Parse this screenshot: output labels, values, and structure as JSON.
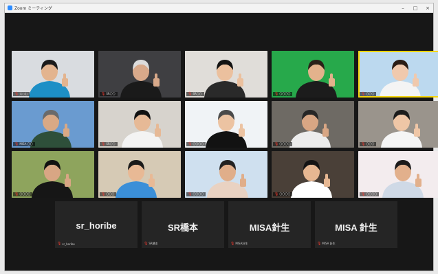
{
  "window": {
    "title": "Zoom ミーティング"
  },
  "tiles": [
    {
      "name": "大○山",
      "bg": "#d9dce0",
      "shirt": "#1d8fc6",
      "skin": "#e3b48f",
      "hair": "#1b1b1b"
    },
    {
      "name": "SR〇〇",
      "bg": "#3f3f42",
      "shirt": "#1a1a1a",
      "skin": "#d8a98a",
      "hair": "#dcdcdc"
    },
    {
      "name": "SR〇〇",
      "bg": "#e0ddd9",
      "shirt": "#2a2a2a",
      "skin": "#ebc09e",
      "hair": "#121212"
    },
    {
      "name": "〇〇〇〇",
      "bg": "#27a94b",
      "shirt": "#1c1c1c",
      "skin": "#e3b28c",
      "hair": "#2a2118"
    },
    {
      "name": "〇〇〇",
      "bg": "#bcd9ef",
      "shirt": "#f4f4f4",
      "skin": "#f0c9ad",
      "hair": "#2a1c14"
    },
    {
      "name": "MISA 〇〇",
      "bg": "#6a9bd0",
      "shirt": "#2e4f3a",
      "skin": "#d9a985",
      "hair": "#6a6a6a"
    },
    {
      "name": "SR〇〇",
      "bg": "#d7d3cd",
      "shirt": "#f3f3f3",
      "skin": "#e6b996",
      "hair": "#111111"
    },
    {
      "name": "〇〇〇〇",
      "bg": "#f0f3f6",
      "shirt": "#121212",
      "skin": "#ecc3a2",
      "hair": "#4a4a4a"
    },
    {
      "name": "〇〇〇〇",
      "bg": "#6e6a64",
      "shirt": "#ececec",
      "skin": "#d8a684",
      "hair": "#262626"
    },
    {
      "name": "〇〇〇",
      "bg": "#9a948c",
      "shirt": "#f5f5f5",
      "skin": "#efc6a6",
      "hair": "#1c1c1c"
    },
    {
      "name": "〇〇〇〇",
      "bg": "#8ea45d",
      "shirt": "#161616",
      "skin": "#d8a684",
      "hair": "#111111"
    },
    {
      "name": "〇〇〇",
      "bg": "#d6cab5",
      "shirt": "#3b8fd8",
      "skin": "#e8b995",
      "hair": "#1a1a1a"
    },
    {
      "name": "〇〇〇〇",
      "bg": "#cfe0ef",
      "shirt": "#e9d2c2",
      "skin": "#e0ae8a",
      "hair": "#222222"
    },
    {
      "name": "〇〇〇〇",
      "bg": "#4a4038",
      "shirt": "#ffffff",
      "skin": "#e6b792",
      "hair": "#141414"
    },
    {
      "name": "〇〇〇〇",
      "bg": "#f3ecee",
      "shirt": "#cfd9e6",
      "skin": "#e2b08c",
      "hair": "#1b1b1b"
    }
  ],
  "name_cards": [
    {
      "display": "sr_horibe",
      "caption": "sr_horibe"
    },
    {
      "display": "SR橋本",
      "caption": "SR橋本"
    },
    {
      "display": "MISA針生",
      "caption": "MISA針生"
    },
    {
      "display": "MISA 針生",
      "caption": "MISA 針生"
    }
  ],
  "colors": {
    "active_speaker": "#f6d60b",
    "muted_mic": "#ff3b30"
  }
}
